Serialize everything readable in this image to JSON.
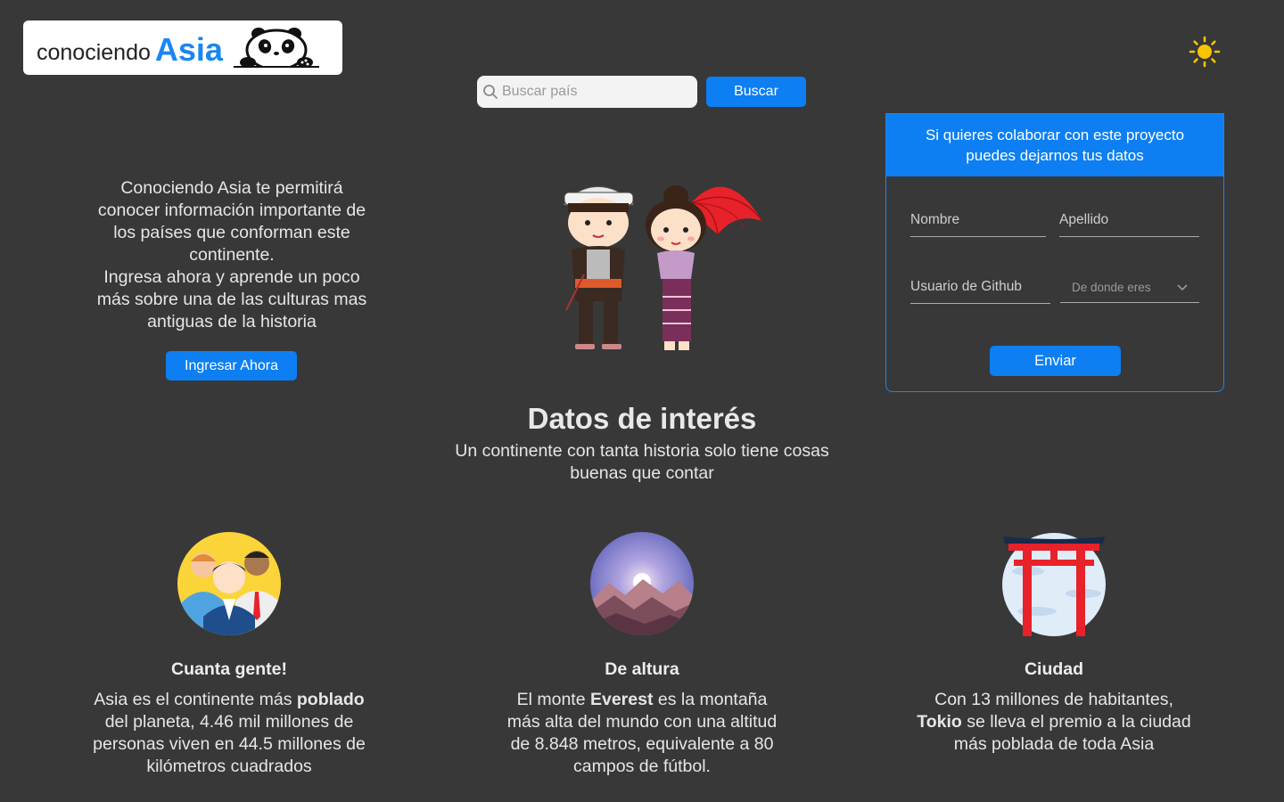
{
  "logo": {
    "word1": "conociendo",
    "word2": "Asia",
    "icon": "panda-icon"
  },
  "theme_toggle": {
    "icon": "sun-icon",
    "color": "#f7c400"
  },
  "search": {
    "placeholder": "Buscar país",
    "button_label": "Buscar",
    "icon": "search-icon"
  },
  "intro": {
    "paragraph1": "Conociendo Asia te permitirá conocer información importante de los países que conforman este continente.",
    "paragraph2": "Ingresa ahora y aprende un poco más sobre una de las culturas mas antiguas de la historia",
    "button_label": "Ingresar Ahora"
  },
  "hero_illustration": "asian-couple-illustration",
  "form": {
    "header": "Si quieres colaborar con este proyecto puedes dejarnos tus datos",
    "first_name_placeholder": "Nombre",
    "last_name_placeholder": "Apellido",
    "github_placeholder": "Usuario de Github",
    "origin_select": "De donde eres",
    "submit_label": "Enviar"
  },
  "interest": {
    "title": "Datos de interés",
    "subtitle": "Un continente con tanta historia solo tiene cosas buenas que contar"
  },
  "features": [
    {
      "icon": "people-icon",
      "title": "Cuanta gente!",
      "text_before": "Asia es el continente más ",
      "bold": "poblado",
      "text_after": " del planeta, 4.46 mil millones de personas viven en 44.5 millones de kilómetros cuadrados"
    },
    {
      "icon": "mountain-icon",
      "title": "De altura",
      "text_before": "El monte ",
      "bold": "Everest",
      "text_after": " es la montaña más alta del mundo con una altitud de 8.848 metros, equivalente a 80 campos de fútbol."
    },
    {
      "icon": "torii-gate-icon",
      "title": "Ciudad",
      "text_before": "Con 13 millones de habitantes, ",
      "bold": "Tokio",
      "text_after": " se lleva el premio a la ciudad más poblada de toda Asia"
    }
  ],
  "colors": {
    "background": "#383838",
    "accent": "#0d7ff2"
  }
}
